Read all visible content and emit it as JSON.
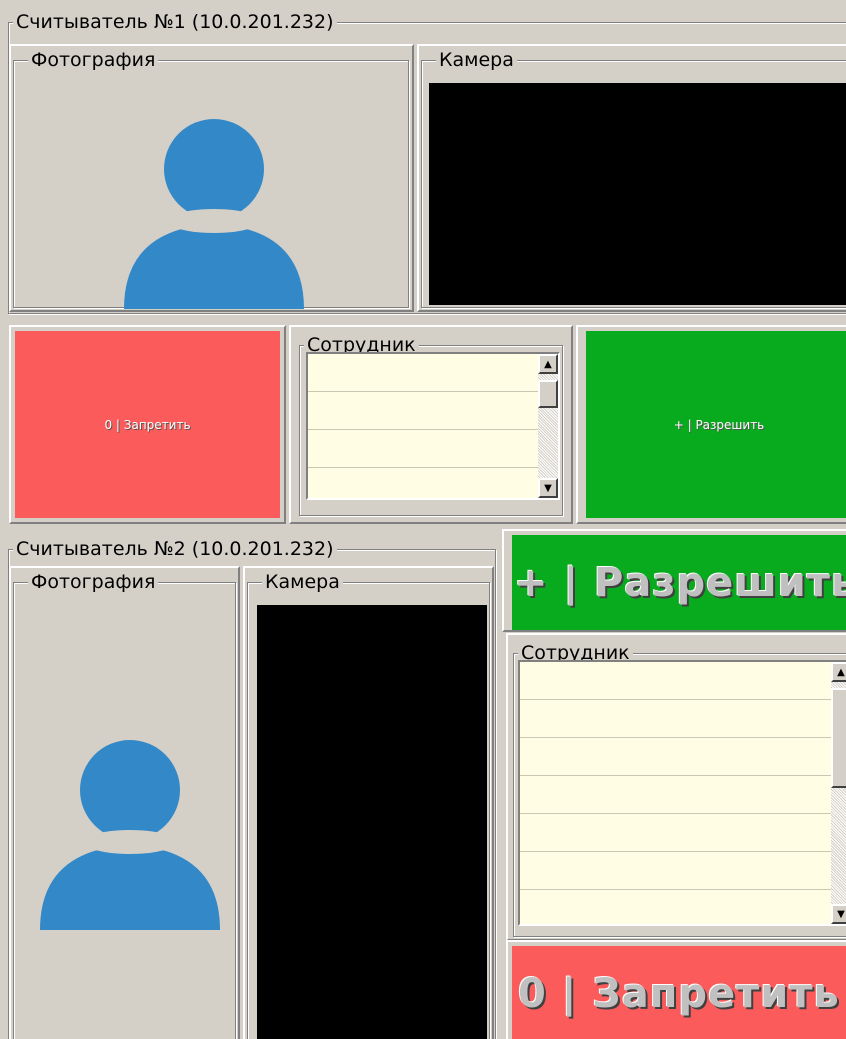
{
  "reader1": {
    "title": "Считыватель №1 (10.0.201.232)",
    "photo_label": "Фотография",
    "camera_label": "Камера",
    "employee_label": "Сотрудник",
    "deny_label": "0 | Запретить",
    "allow_label": "+ | Разрешить",
    "scroll_up_icon": "▲",
    "scroll_down_icon": "▼"
  },
  "reader2": {
    "title": "Считыватель №2 (10.0.201.232)",
    "photo_label": "Фотография",
    "camera_label": "Камера",
    "employee_label": "Сотрудник",
    "allow_label": "+ | Разрешить",
    "deny_label": "0 | Запретить",
    "scroll_up_icon": "▲",
    "scroll_down_icon": "▼"
  },
  "colors": {
    "background": "#d4d0c8",
    "deny": "#fc5b5b",
    "allow": "#08ab1e",
    "avatar": "#3388c8",
    "camera": "#000000",
    "listbox": "#fffde4"
  },
  "icons": {
    "avatar": "user-silhouette-icon",
    "scroll_up": "arrow-up-icon",
    "scroll_down": "arrow-down-icon"
  }
}
